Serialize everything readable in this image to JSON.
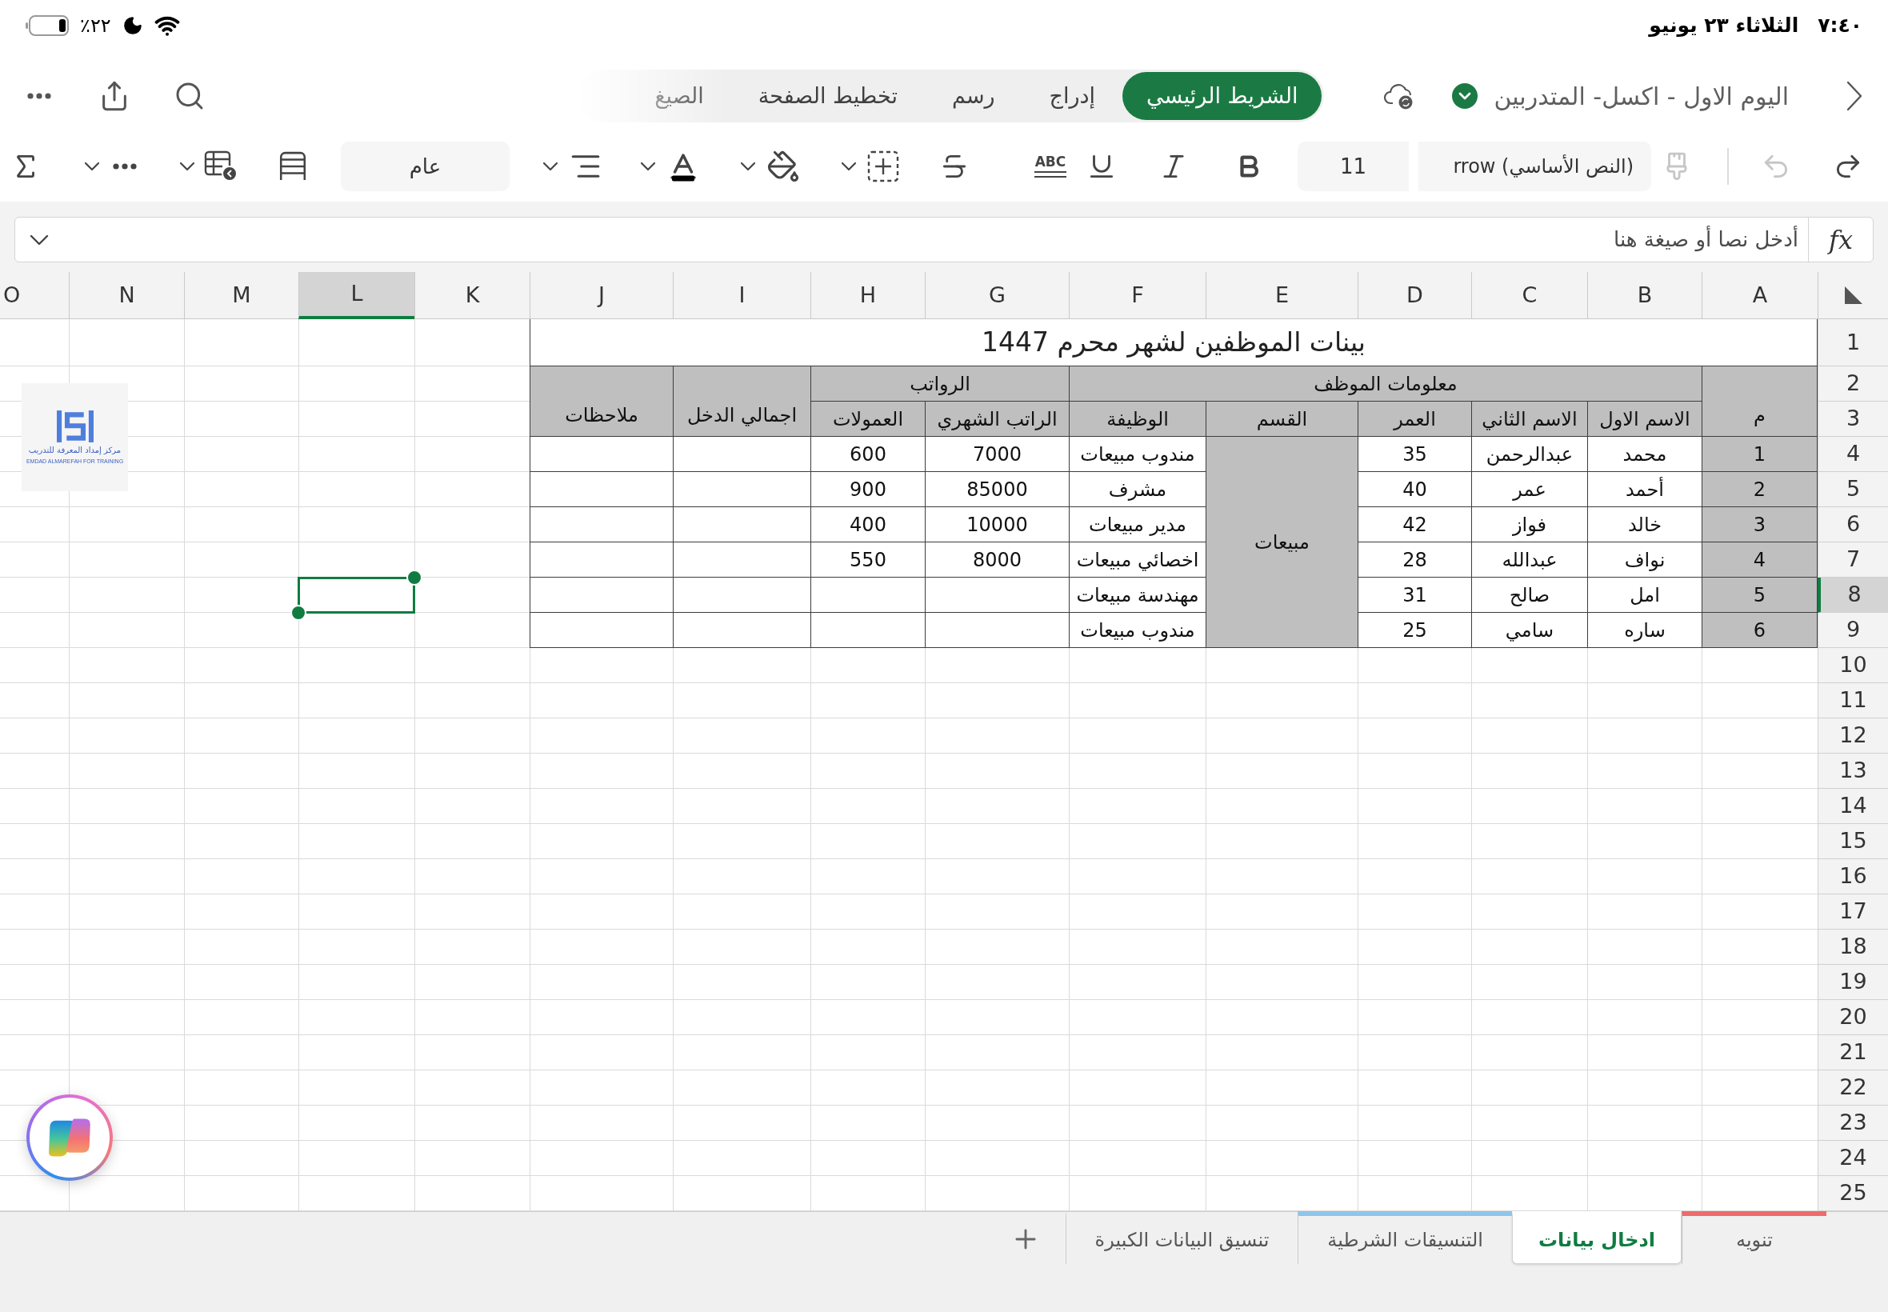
{
  "status_bar": {
    "time": "٧:٤٠",
    "date": "الثلاثاء ٢٣ يونيو",
    "battery": "٢٢٪"
  },
  "title_bar": {
    "document_title": "اليوم الاول - اكسل- المتدربين"
  },
  "ribbon_tabs": [
    {
      "label": "الشريط الرئيسي",
      "selected": true
    },
    {
      "label": "إدراج",
      "selected": false
    },
    {
      "label": "رسم",
      "selected": false
    },
    {
      "label": "تخطيط الصفحة",
      "selected": false
    },
    {
      "label": "الصيغ",
      "selected": false
    }
  ],
  "toolbar": {
    "redo": {
      "disabled": false
    },
    "undo": {
      "disabled": true
    },
    "format_painter": {
      "disabled": true
    },
    "font_name": "rrow (النص الأساسي)",
    "font_size": "11",
    "double_underline_label": "ABC",
    "number_format": "عام"
  },
  "formula_bar": {
    "fx_label": "fx",
    "placeholder": "أدخل نصا أو صيغة هنا"
  },
  "sheet": {
    "columns": [
      {
        "label": "A",
        "selected": false
      },
      {
        "label": "B",
        "selected": false
      },
      {
        "label": "C",
        "selected": false
      },
      {
        "label": "D",
        "selected": false
      },
      {
        "label": "E",
        "selected": false
      },
      {
        "label": "F",
        "selected": false
      },
      {
        "label": "G",
        "selected": false
      },
      {
        "label": "H",
        "selected": false
      },
      {
        "label": "I",
        "selected": false
      },
      {
        "label": "J",
        "selected": false
      },
      {
        "label": "K",
        "selected": false
      },
      {
        "label": "L",
        "selected": true
      },
      {
        "label": "M",
        "selected": false
      },
      {
        "label": "N",
        "selected": false
      },
      {
        "label": "O",
        "selected": false
      }
    ],
    "rows": [
      {
        "label": "1",
        "selected": false
      },
      {
        "label": "2",
        "selected": false
      },
      {
        "label": "3",
        "selected": false
      },
      {
        "label": "4",
        "selected": false
      },
      {
        "label": "5",
        "selected": false
      },
      {
        "label": "6",
        "selected": false
      },
      {
        "label": "7",
        "selected": false
      },
      {
        "label": "8",
        "selected": true
      },
      {
        "label": "9",
        "selected": false
      },
      {
        "label": "10",
        "selected": false
      },
      {
        "label": "11",
        "selected": false
      },
      {
        "label": "12",
        "selected": false
      },
      {
        "label": "13",
        "selected": false
      },
      {
        "label": "14",
        "selected": false
      },
      {
        "label": "15",
        "selected": false
      },
      {
        "label": "16",
        "selected": false
      },
      {
        "label": "17",
        "selected": false
      },
      {
        "label": "18",
        "selected": false
      },
      {
        "label": "19",
        "selected": false
      },
      {
        "label": "20",
        "selected": false
      },
      {
        "label": "21",
        "selected": false
      },
      {
        "label": "22",
        "selected": false
      },
      {
        "label": "23",
        "selected": false
      },
      {
        "label": "24",
        "selected": false
      },
      {
        "label": "25",
        "selected": false
      }
    ],
    "table": {
      "title": "بينات الموظفين لشهر محرم 1447",
      "index_header": "م",
      "employee_info": {
        "label": "معلومات الموظف",
        "columns": [
          "الاسم الاول",
          "الاسم الثاني",
          "العمر",
          "القسم",
          "الوظيفة"
        ]
      },
      "salaries": {
        "label": "الرواتب",
        "columns": [
          "الراتب الشهري",
          "العمولات"
        ]
      },
      "total_income_header": "اجمالي الدخل",
      "notes_header": "ملاحظات",
      "department": "مبيعات",
      "rows": [
        {
          "number": "1",
          "first_name": "محمد",
          "second_name": "عبدالرحمن",
          "age": "35",
          "job": "مندوب مبيعات",
          "monthly_salary": "7000",
          "commission": "600"
        },
        {
          "number": "2",
          "first_name": "أحمد",
          "second_name": "عمر",
          "age": "40",
          "job": "مشرف",
          "monthly_salary": "85000",
          "commission": "900"
        },
        {
          "number": "3",
          "first_name": "خالد",
          "second_name": "فواز",
          "age": "42",
          "job": "مدير مبيعات",
          "monthly_salary": "10000",
          "commission": "400"
        },
        {
          "number": "4",
          "first_name": "نواف",
          "second_name": "عبدالله",
          "age": "28",
          "job": "اخصائي مبيعات",
          "monthly_salary": "8000",
          "commission": "550"
        },
        {
          "number": "5",
          "first_name": "امل",
          "second_name": "صالح",
          "age": "31",
          "job": "مهندسة مبيعات"
        },
        {
          "number": "6",
          "first_name": "ساره",
          "second_name": "سامي",
          "age": "25",
          "job": "مندوب مبيعات"
        }
      ]
    }
  },
  "logo": {
    "arabic_name": "مركز إمداد المعرفة للتدريب",
    "english_name": "EMDAD ALMAREFAH FOR TRAINING"
  },
  "sheet_tabs": [
    {
      "label": "تنويه",
      "selected": false,
      "color": "#ef6b6b"
    },
    {
      "label": "ادخال بيانات",
      "selected": true
    },
    {
      "label": "التنسيقات الشرطية",
      "selected": false,
      "color": "#8ec5ea"
    },
    {
      "label": "تنسيق البيانات الكبيرة",
      "selected": false
    }
  ]
}
